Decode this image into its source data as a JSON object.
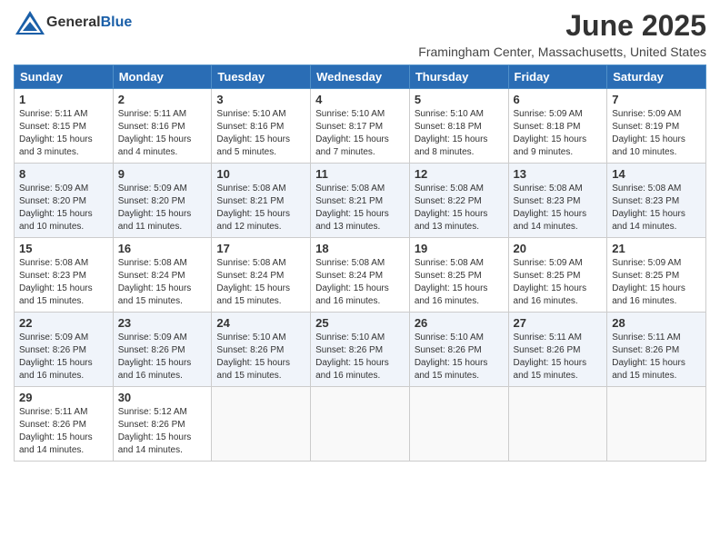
{
  "header": {
    "logo_general": "General",
    "logo_blue": "Blue",
    "month_title": "June 2025",
    "location": "Framingham Center, Massachusetts, United States"
  },
  "weekdays": [
    "Sunday",
    "Monday",
    "Tuesday",
    "Wednesday",
    "Thursday",
    "Friday",
    "Saturday"
  ],
  "weeks": [
    [
      {
        "day": 1,
        "sunrise": "5:11 AM",
        "sunset": "8:15 PM",
        "daylight": "15 hours and 3 minutes."
      },
      {
        "day": 2,
        "sunrise": "5:11 AM",
        "sunset": "8:16 PM",
        "daylight": "15 hours and 4 minutes."
      },
      {
        "day": 3,
        "sunrise": "5:10 AM",
        "sunset": "8:16 PM",
        "daylight": "15 hours and 5 minutes."
      },
      {
        "day": 4,
        "sunrise": "5:10 AM",
        "sunset": "8:17 PM",
        "daylight": "15 hours and 7 minutes."
      },
      {
        "day": 5,
        "sunrise": "5:10 AM",
        "sunset": "8:18 PM",
        "daylight": "15 hours and 8 minutes."
      },
      {
        "day": 6,
        "sunrise": "5:09 AM",
        "sunset": "8:18 PM",
        "daylight": "15 hours and 9 minutes."
      },
      {
        "day": 7,
        "sunrise": "5:09 AM",
        "sunset": "8:19 PM",
        "daylight": "15 hours and 10 minutes."
      }
    ],
    [
      {
        "day": 8,
        "sunrise": "5:09 AM",
        "sunset": "8:20 PM",
        "daylight": "15 hours and 10 minutes."
      },
      {
        "day": 9,
        "sunrise": "5:09 AM",
        "sunset": "8:20 PM",
        "daylight": "15 hours and 11 minutes."
      },
      {
        "day": 10,
        "sunrise": "5:08 AM",
        "sunset": "8:21 PM",
        "daylight": "15 hours and 12 minutes."
      },
      {
        "day": 11,
        "sunrise": "5:08 AM",
        "sunset": "8:21 PM",
        "daylight": "15 hours and 13 minutes."
      },
      {
        "day": 12,
        "sunrise": "5:08 AM",
        "sunset": "8:22 PM",
        "daylight": "15 hours and 13 minutes."
      },
      {
        "day": 13,
        "sunrise": "5:08 AM",
        "sunset": "8:23 PM",
        "daylight": "15 hours and 14 minutes."
      },
      {
        "day": 14,
        "sunrise": "5:08 AM",
        "sunset": "8:23 PM",
        "daylight": "15 hours and 14 minutes."
      }
    ],
    [
      {
        "day": 15,
        "sunrise": "5:08 AM",
        "sunset": "8:23 PM",
        "daylight": "15 hours and 15 minutes."
      },
      {
        "day": 16,
        "sunrise": "5:08 AM",
        "sunset": "8:24 PM",
        "daylight": "15 hours and 15 minutes."
      },
      {
        "day": 17,
        "sunrise": "5:08 AM",
        "sunset": "8:24 PM",
        "daylight": "15 hours and 15 minutes."
      },
      {
        "day": 18,
        "sunrise": "5:08 AM",
        "sunset": "8:24 PM",
        "daylight": "15 hours and 16 minutes."
      },
      {
        "day": 19,
        "sunrise": "5:08 AM",
        "sunset": "8:25 PM",
        "daylight": "15 hours and 16 minutes."
      },
      {
        "day": 20,
        "sunrise": "5:09 AM",
        "sunset": "8:25 PM",
        "daylight": "15 hours and 16 minutes."
      },
      {
        "day": 21,
        "sunrise": "5:09 AM",
        "sunset": "8:25 PM",
        "daylight": "15 hours and 16 minutes."
      }
    ],
    [
      {
        "day": 22,
        "sunrise": "5:09 AM",
        "sunset": "8:26 PM",
        "daylight": "15 hours and 16 minutes."
      },
      {
        "day": 23,
        "sunrise": "5:09 AM",
        "sunset": "8:26 PM",
        "daylight": "15 hours and 16 minutes."
      },
      {
        "day": 24,
        "sunrise": "5:10 AM",
        "sunset": "8:26 PM",
        "daylight": "15 hours and 15 minutes."
      },
      {
        "day": 25,
        "sunrise": "5:10 AM",
        "sunset": "8:26 PM",
        "daylight": "15 hours and 16 minutes."
      },
      {
        "day": 26,
        "sunrise": "5:10 AM",
        "sunset": "8:26 PM",
        "daylight": "15 hours and 15 minutes."
      },
      {
        "day": 27,
        "sunrise": "5:11 AM",
        "sunset": "8:26 PM",
        "daylight": "15 hours and 15 minutes."
      },
      {
        "day": 28,
        "sunrise": "5:11 AM",
        "sunset": "8:26 PM",
        "daylight": "15 hours and 15 minutes."
      }
    ],
    [
      {
        "day": 29,
        "sunrise": "5:11 AM",
        "sunset": "8:26 PM",
        "daylight": "15 hours and 14 minutes."
      },
      {
        "day": 30,
        "sunrise": "5:12 AM",
        "sunset": "8:26 PM",
        "daylight": "15 hours and 14 minutes."
      },
      null,
      null,
      null,
      null,
      null
    ]
  ]
}
